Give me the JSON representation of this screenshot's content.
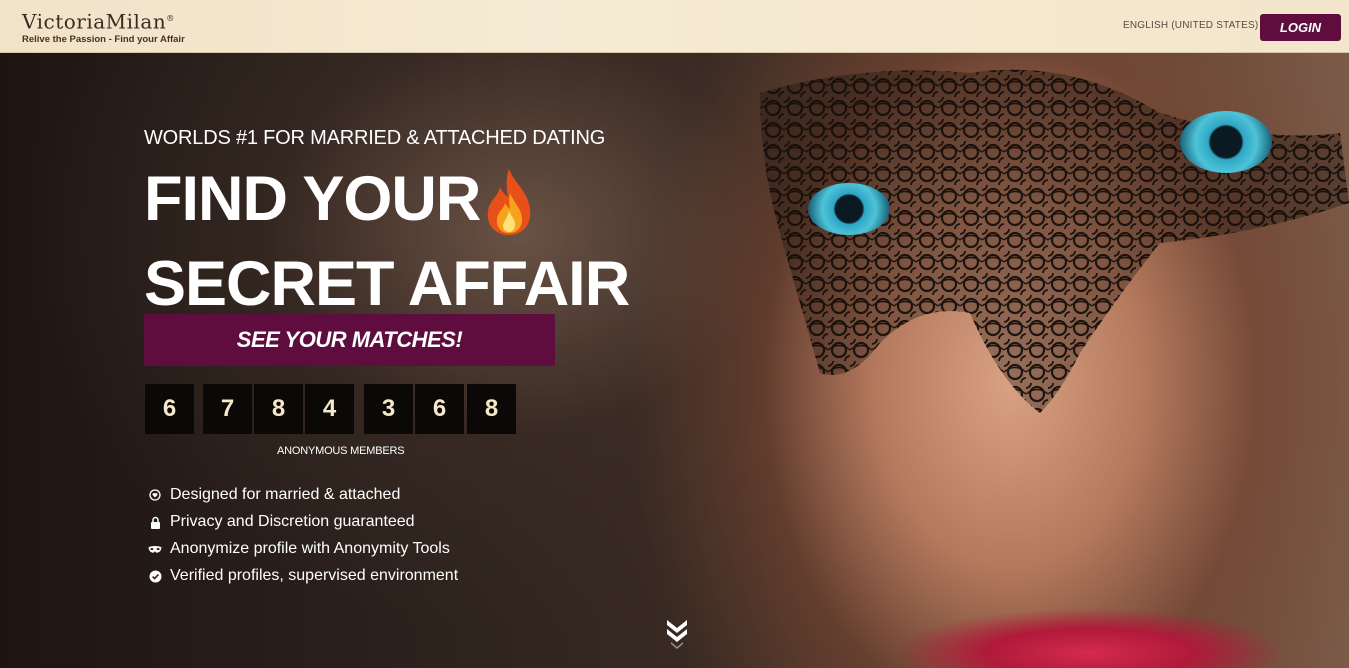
{
  "header": {
    "logo_word": "VictoriaMilan",
    "logo_reg": "®",
    "logo_tagline": "Relive the Passion - Find your Affair",
    "language": "ENGLISH (UNITED STATES)",
    "login_label": "LOGIN"
  },
  "hero": {
    "kicker": "WORLDS #1 FOR MARRIED & ATTACHED DATING",
    "headline_line1": "FIND YOUR",
    "headline_line2": "SECRET AFFAIR",
    "cta_label": "SEE YOUR MATCHES!",
    "counter_digits": [
      "6",
      "7",
      "8",
      "4",
      "3",
      "6",
      "8"
    ],
    "counter_label": "ANONYMOUS MEMBERS",
    "features": [
      {
        "icon": "heart-pin-icon",
        "text": "Designed for married & attached"
      },
      {
        "icon": "lock-icon",
        "text": "Privacy and Discretion guaranteed"
      },
      {
        "icon": "mask-icon",
        "text": "Anonymize profile with Anonymity Tools"
      },
      {
        "icon": "check-badge-icon",
        "text": "Verified profiles, supervised environment"
      }
    ],
    "scroll_icon": "chevron-double-down-icon"
  },
  "colors": {
    "brand_purple": "#5e0d3e",
    "header_bg": "#f3e6cc",
    "digit_bg": "#0b0908",
    "digit_text": "#f6e8c8"
  }
}
